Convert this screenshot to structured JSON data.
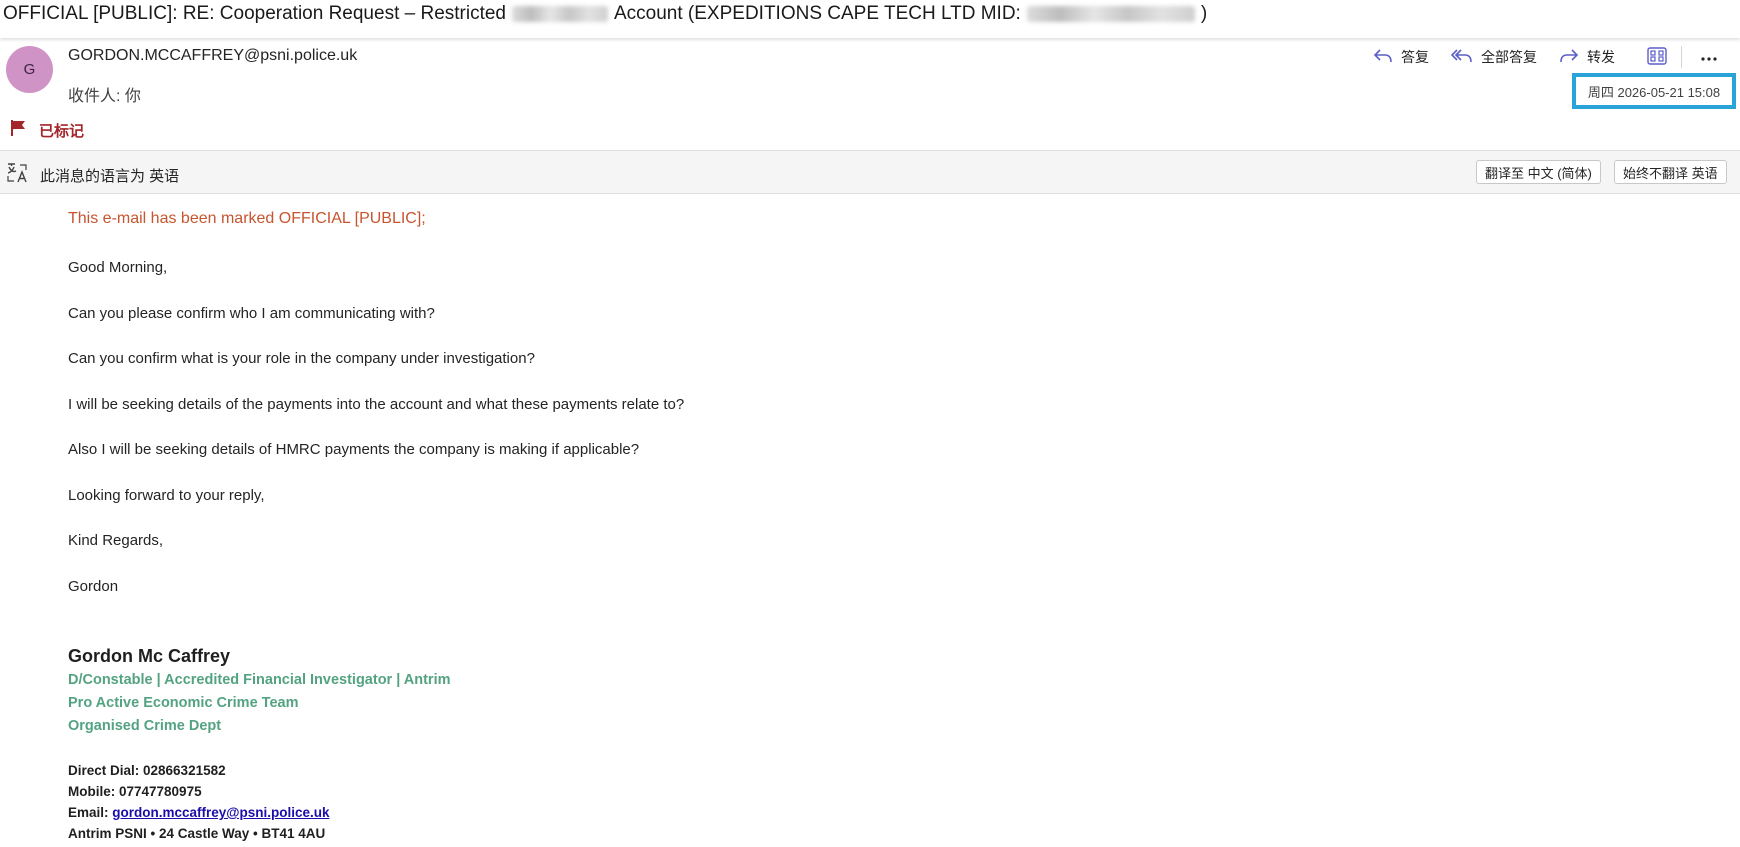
{
  "subject": {
    "prefix": "OFFICIAL [PUBLIC]: RE: Cooperation Request – Restricted",
    "middle": "Account (EXPEDITIONS CAPE TECH LTD   MID:",
    "suffix": ")"
  },
  "sender": {
    "avatar_initial": "G",
    "email": "GORDON.MCCAFFREY@psni.police.uk",
    "recipient_label": "收件人:",
    "recipient_value": "你",
    "flag_label": "已标记"
  },
  "actions": {
    "reply": "答复",
    "reply_all": "全部答复",
    "forward": "转发",
    "date": "周四 2026-05-21 15:08"
  },
  "translation": {
    "note": "此消息的语言为 英语",
    "translate_button": "翻译至 中文 (简体)",
    "never_translate_button": "始终不翻译 英语"
  },
  "body": {
    "marking": "This e-mail has been marked OFFICIAL [PUBLIC];",
    "paragraphs": [
      "Good Morning,",
      "Can you please confirm who I am communicating with?",
      "Can you confirm what is your role in the company under investigation?",
      "I will be seeking details of the payments into the account and what these payments relate to?",
      "Also I will be seeking details of HMRC payments the company is making if applicable?",
      "Looking forward to your reply,",
      "Kind Regards,",
      "Gordon"
    ]
  },
  "signature": {
    "name": "Gordon Mc Caffrey",
    "title": "D/Constable | Accredited Financial Investigator | Antrim",
    "team": "Pro Active Economic Crime Team",
    "dept": "Organised Crime Dept",
    "direct_dial": "Direct Dial: 02866321582",
    "mobile": "Mobile: 07747780975",
    "email_label": "Email:",
    "email": "gordon.mccaffrey@psni.police.uk",
    "address": "Antrim PSNI • 24 Castle Way  • BT41 4AU"
  },
  "colors": {
    "accent_highlight": "#2aa3d8",
    "avatar": "#cf93c6",
    "flag": "#a4262c",
    "marking": "#c7552f",
    "signature_green": "#53a382"
  }
}
